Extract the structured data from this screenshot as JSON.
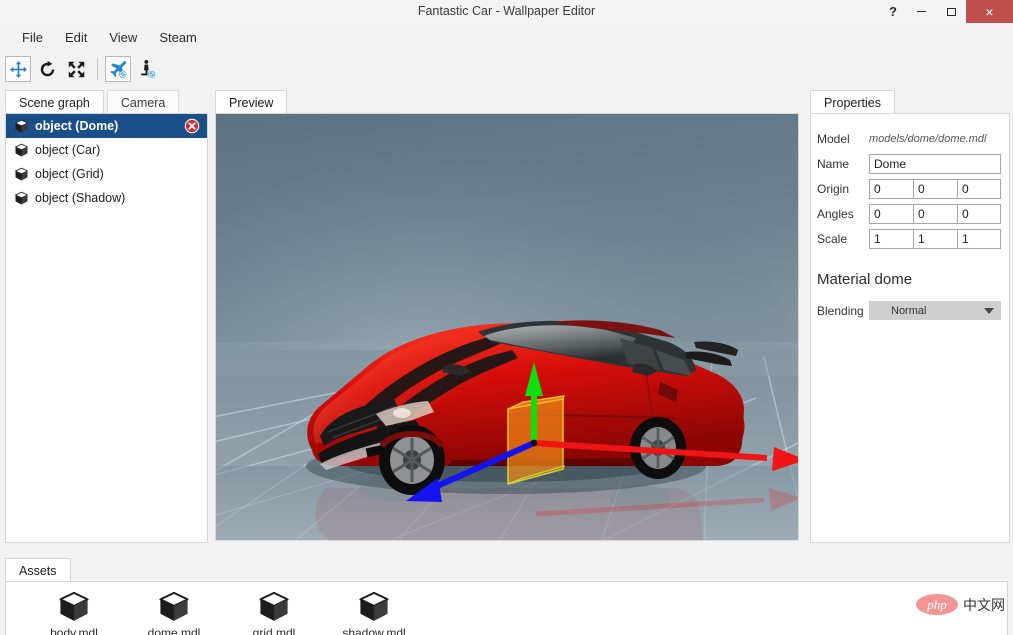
{
  "window": {
    "title": "Fantastic Car - Wallpaper Editor",
    "help_label": "?",
    "minimize_label": "",
    "maximize_label": "",
    "close_label": "×",
    "close_color": "#c0504d"
  },
  "menu": {
    "items": [
      {
        "label": "File"
      },
      {
        "label": "Edit"
      },
      {
        "label": "View"
      },
      {
        "label": "Steam"
      }
    ]
  },
  "toolbar": {
    "tools": [
      {
        "name": "move-tool",
        "icon": "move-icon",
        "active": true
      },
      {
        "name": "rotate-tool",
        "icon": "rotate-icon",
        "active": false
      },
      {
        "name": "scale-tool",
        "icon": "scale-icon",
        "active": false
      }
    ],
    "camera_tools": [
      {
        "name": "fly-camera-tool",
        "icon": "airplane-icon",
        "active": true
      },
      {
        "name": "walk-camera-tool",
        "icon": "person-icon",
        "active": false
      }
    ]
  },
  "scene_graph": {
    "tabs": [
      {
        "label": "Scene graph",
        "active": true
      },
      {
        "label": "Camera",
        "active": false
      }
    ],
    "items": [
      {
        "label": "object (Dome)",
        "selected": true,
        "deletable": true
      },
      {
        "label": "object (Car)",
        "selected": false,
        "deletable": false
      },
      {
        "label": "object (Grid)",
        "selected": false,
        "deletable": false
      },
      {
        "label": "object (Shadow)",
        "selected": false,
        "deletable": false
      }
    ]
  },
  "preview": {
    "tabs": [
      {
        "label": "Preview",
        "active": true
      }
    ],
    "scene": {
      "background_top": "#6b7f8d",
      "background_bottom": "#8d9ea9",
      "floor_grid_color": "#b8d4e4",
      "car_color": "#d8130f",
      "gizmo": {
        "x_axis_color": "#ee1111",
        "y_axis_color": "#11dd11",
        "z_axis_color": "#1111dd",
        "box_fill": "#f0921e",
        "box_outline": "#ffff33"
      }
    }
  },
  "properties": {
    "tabs": [
      {
        "label": "Properties",
        "active": true
      }
    ],
    "fields": [
      {
        "label": "Model",
        "type": "static",
        "value": "models/dome/dome.mdl"
      },
      {
        "label": "Name",
        "type": "text",
        "value": "Dome"
      },
      {
        "label": "Origin",
        "type": "vec3",
        "values": [
          "0",
          "0",
          "0"
        ]
      },
      {
        "label": "Angles",
        "type": "vec3",
        "values": [
          "0",
          "0",
          "0"
        ]
      },
      {
        "label": "Scale",
        "type": "vec3",
        "values": [
          "1",
          "1",
          "1"
        ]
      }
    ],
    "material": {
      "title": "Material dome",
      "blending_label": "Blending",
      "blending_value": "Normal"
    }
  },
  "assets": {
    "tabs": [
      {
        "label": "Assets",
        "active": true
      }
    ],
    "items": [
      {
        "label": "body.mdl",
        "icon": "cube-icon"
      },
      {
        "label": "dome.mdl",
        "icon": "cube-icon"
      },
      {
        "label": "grid.mdl",
        "icon": "cube-icon"
      },
      {
        "label": "shadow.mdl",
        "icon": "cube-icon"
      }
    ]
  },
  "watermark": {
    "brand": "php",
    "suffix": "中文网"
  }
}
